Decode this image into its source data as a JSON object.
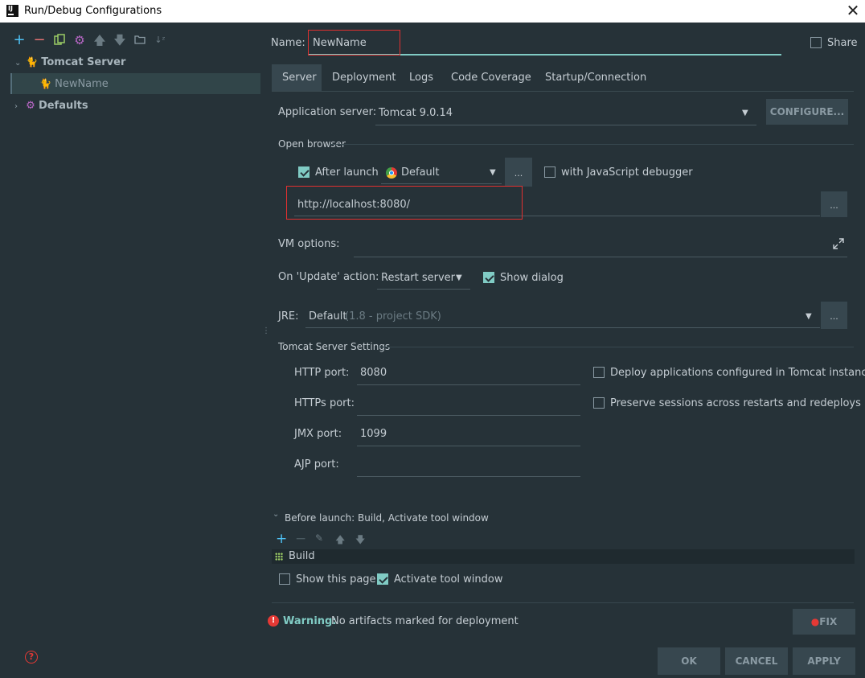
{
  "window": {
    "title": "Run/Debug Configurations",
    "app_icon_text": "IJ"
  },
  "left": {
    "toolbar": [
      "add-icon",
      "remove-icon",
      "copy-icon",
      "settings-icon",
      "move-up-icon",
      "move-down-icon",
      "folder-icon",
      "sort-icon"
    ],
    "tree": [
      {
        "label": "Tomcat Server",
        "expanded": true
      },
      {
        "label": "NewName",
        "selected": true
      },
      {
        "label": "Defaults",
        "expanded": false
      }
    ],
    "help_icon": "help-icon"
  },
  "name_row": {
    "label": "Name:",
    "value": "NewName",
    "share_label": "Share"
  },
  "tabs": [
    "Server",
    "Deployment",
    "Logs",
    "Code Coverage",
    "Startup/Connection"
  ],
  "server": {
    "app_server_label": "Application server:",
    "app_server_value": "Tomcat 9.0.14",
    "configure_label": "CONFIGURE...",
    "open_browser_label": "Open browser",
    "after_launch_label": "After launch",
    "browser_value": "Default",
    "dots": "...",
    "js_debugger_label": "with JavaScript debugger",
    "url_value": "http://localhost:8080/",
    "vm_options_label": "VM options:",
    "update_action_label": "On 'Update' action:",
    "update_action_value": "Restart server",
    "show_dialog_label": "Show dialog",
    "jre_label": "JRE:",
    "jre_value": "Default",
    "jre_hint": "(1.8 - project SDK)",
    "tomcat_settings_label": "Tomcat Server Settings",
    "http_port_label": "HTTP port:",
    "http_port_value": "8080",
    "https_port_label": "HTTPs port:",
    "https_port_value": "",
    "jmx_port_label": "JMX port:",
    "jmx_port_value": "1099",
    "ajp_port_label": "AJP port:",
    "ajp_port_value": "",
    "deploy_apps_label": "Deploy applications configured in Tomcat instance",
    "preserve_sessions_label": "Preserve sessions across restarts and redeploys"
  },
  "before_launch": {
    "header": "Before launch: Build, Activate tool window",
    "item": "Build",
    "show_page_label": "Show this page",
    "activate_tool_label": "Activate tool window"
  },
  "warning": {
    "bold": "Warning:",
    "text": "No artifacts marked for deployment",
    "fix_label": "FIX"
  },
  "footer": {
    "ok": "OK",
    "cancel": "CANCEL",
    "apply": "APPLY"
  },
  "colors": {
    "bg": "#263238",
    "accent": "#80cbc4",
    "panel": "#37474f",
    "highlight": "#e03030",
    "warning": "#e53935"
  }
}
